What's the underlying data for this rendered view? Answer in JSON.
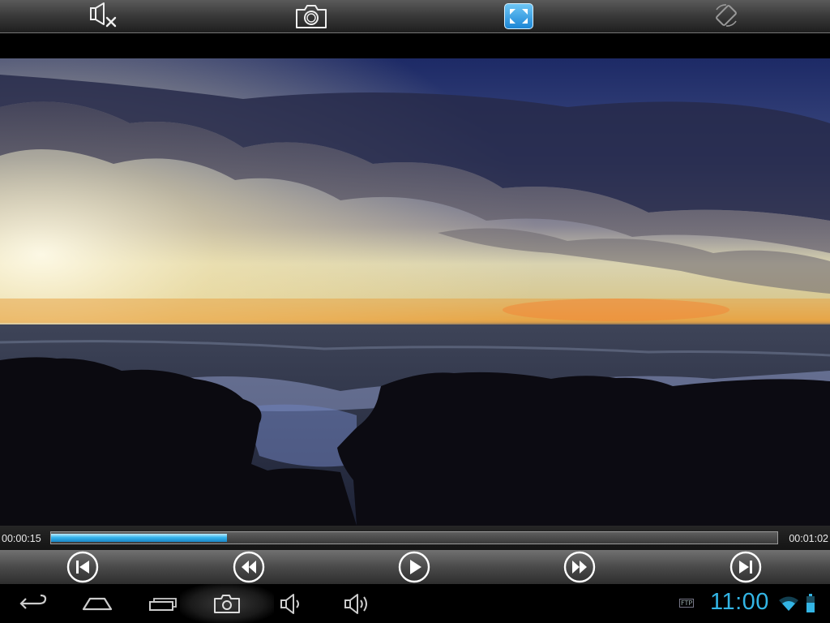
{
  "top_toolbar": {
    "buttons": [
      {
        "icon": "mute-icon",
        "active": false
      },
      {
        "icon": "camera-icon",
        "active": false
      },
      {
        "icon": "fullscreen-icon",
        "active": true
      },
      {
        "icon": "screen-rotate-icon",
        "active": false
      }
    ]
  },
  "player": {
    "elapsed": "00:00:15",
    "total": "00:01:02",
    "progress_fraction": 0.242,
    "controls": [
      "previous-icon",
      "rewind-icon",
      "play-icon",
      "fast-forward-icon",
      "next-icon"
    ]
  },
  "system_bar": {
    "nav_icons": [
      "back-icon",
      "home-icon",
      "recent-apps-icon",
      "screenshot-icon",
      "volume-down-icon",
      "volume-up-icon"
    ],
    "ftp_label": "FTP",
    "clock": "11:00",
    "status_icons": [
      "wifi-icon",
      "battery-icon"
    ]
  },
  "colors": {
    "accent_blue": "#33b5e5",
    "progress_fill": "#37b4ec",
    "active_button": "#1c86d6"
  }
}
